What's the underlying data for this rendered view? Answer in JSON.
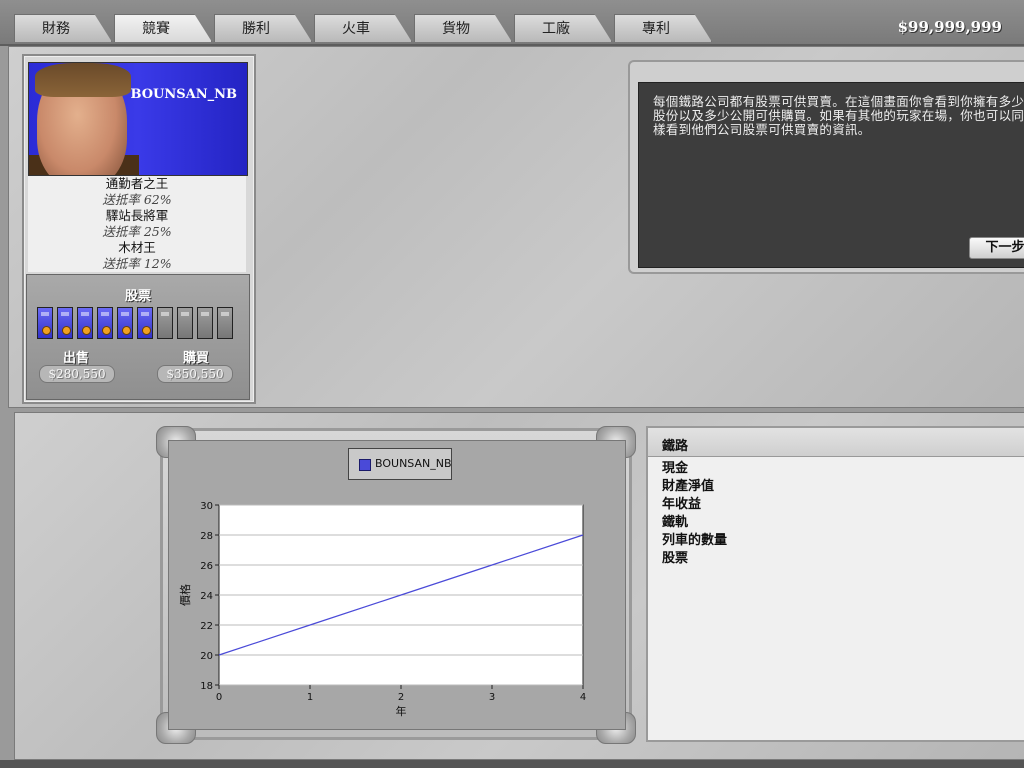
{
  "tabs": [
    "財務",
    "競賽",
    "勝利",
    "火車",
    "貨物",
    "工廠",
    "專利"
  ],
  "active_tab": "競賽",
  "money": "$99,999,999",
  "player": {
    "name": "BOUNSAN_NB",
    "titles": [
      {
        "title": "通勤者之王",
        "rate": "送抵率 62%"
      },
      {
        "title": "驛站長將軍",
        "rate": "送抵率 25%"
      },
      {
        "title": "木材王",
        "rate": "送抵率 12%"
      }
    ],
    "stock_label": "股票",
    "shares_owned": 6,
    "shares_total": 10,
    "sell_label": "出售",
    "buy_label": "購買",
    "sell_price": "$280,550",
    "buy_price": "$350,550"
  },
  "tutorial": {
    "text": "每個鐵路公司都有股票可供買賣。在這個畫面你會看到你擁有多少股份以及多少公開可供購買。如果有其他的玩家在場，你也可以同樣看到他們公司股票可供買賣的資訊。",
    "next_label": "下一步"
  },
  "info_panel": {
    "title": "鐵路",
    "rows": [
      "現金",
      "財產淨值",
      "年收益",
      "鐵軌",
      "列車的數量",
      "股票"
    ]
  },
  "chart_data": {
    "type": "line",
    "title": "",
    "xlabel": "年",
    "ylabel": "價格",
    "x": [
      0,
      1,
      2,
      3,
      4
    ],
    "xlim": [
      0,
      4
    ],
    "ylim": [
      18,
      30
    ],
    "yticks": [
      18,
      20,
      22,
      24,
      26,
      28,
      30
    ],
    "xticks": [
      0,
      1,
      2,
      3,
      4
    ],
    "grid": "horizontal",
    "legend": "top",
    "series": [
      {
        "name": "BOUNSAN_NB",
        "color": "#4a4ad8",
        "values": [
          20,
          22,
          24,
          26,
          28
        ]
      }
    ]
  }
}
